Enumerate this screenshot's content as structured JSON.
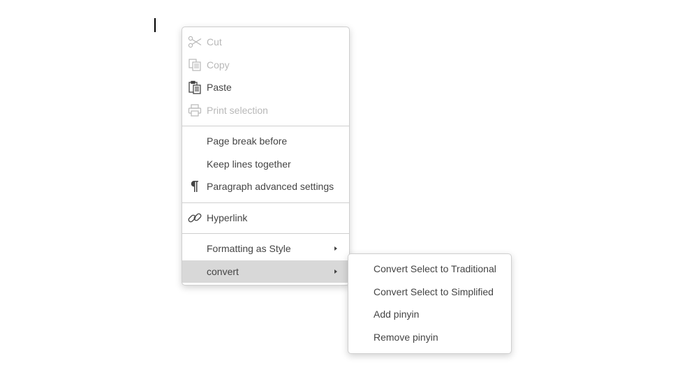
{
  "context_menu": {
    "items": [
      {
        "label": "Cut",
        "icon": "scissors-icon",
        "disabled": true
      },
      {
        "label": "Copy",
        "icon": "copy-icon",
        "disabled": true
      },
      {
        "label": "Paste",
        "icon": "paste-icon",
        "disabled": false
      },
      {
        "label": "Print selection",
        "icon": "printer-icon",
        "disabled": true
      },
      {
        "label": "Page break before"
      },
      {
        "label": "Keep lines together"
      },
      {
        "label": "Paragraph advanced settings",
        "icon": "pilcrow-icon"
      },
      {
        "label": "Hyperlink",
        "icon": "link-icon"
      },
      {
        "label": "Formatting as Style",
        "has_submenu": true
      },
      {
        "label": "convert",
        "has_submenu": true,
        "highlighted": true
      }
    ]
  },
  "submenu": {
    "items": [
      {
        "label": "Convert Select to Traditional"
      },
      {
        "label": "Convert Select to Simplified"
      },
      {
        "label": "Add pinyin"
      },
      {
        "label": "Remove pinyin"
      }
    ]
  },
  "colors": {
    "text": "#444444",
    "disabled_text": "#b8b8b8",
    "highlight": "#d8d8d8",
    "border": "#cfcfcf"
  }
}
